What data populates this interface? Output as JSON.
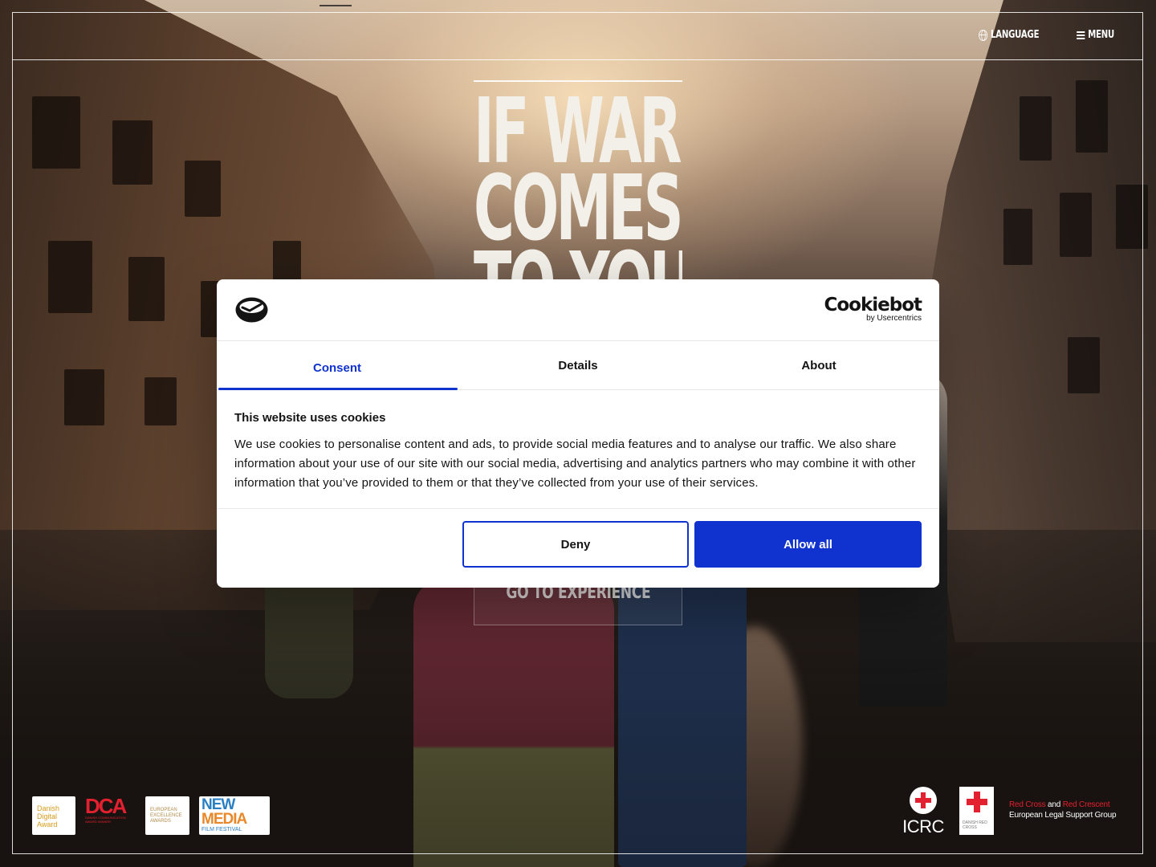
{
  "nav": {
    "language_label": "LANGUAGE",
    "menu_label": "MENU"
  },
  "hero": {
    "title_lines": [
      "IF WAR",
      "COMES",
      "TO YOU"
    ],
    "cta_label": "GO TO EXPERIENCE"
  },
  "cookie_banner": {
    "brand_name": "Cookiebot",
    "brand_sub": "by Usercentrics",
    "tabs": [
      {
        "label": "Consent",
        "active": true
      },
      {
        "label": "Details",
        "active": false
      },
      {
        "label": "About",
        "active": false
      }
    ],
    "heading": "This website uses cookies",
    "body": "We use cookies to personalise content and ads, to provide social media features and to analyse our traffic. We also share information about your use of our site with our social media, advertising and analytics partners who may combine it with other information that you’ve provided to them or that they’ve collected from your use of their services.",
    "deny_label": "Deny",
    "allow_label": "Allow all"
  },
  "footer": {
    "badges": {
      "dda": "Danish Digital Award",
      "dca_big": "DCA",
      "dca_small": "DANISH COMMUNICATION AWARD WINNER",
      "eea": "EUROPEAN EXCELLENCE AWARDS",
      "nmff_line1": "NEW",
      "nmff_line2": "MEDIA",
      "nmff_line3": "FILM FESTIVAL"
    },
    "icrc_label": "ICRC",
    "drc_label": "DANISH RED CROSS",
    "elsg_red_1": "Red Cross",
    "elsg_and": "and",
    "elsg_red_2": "Red Crescent",
    "elsg_line2": "European Legal Support Group"
  },
  "colors": {
    "primary": "#1032cf",
    "text": "#141414",
    "red_cross": "#e3202f"
  }
}
